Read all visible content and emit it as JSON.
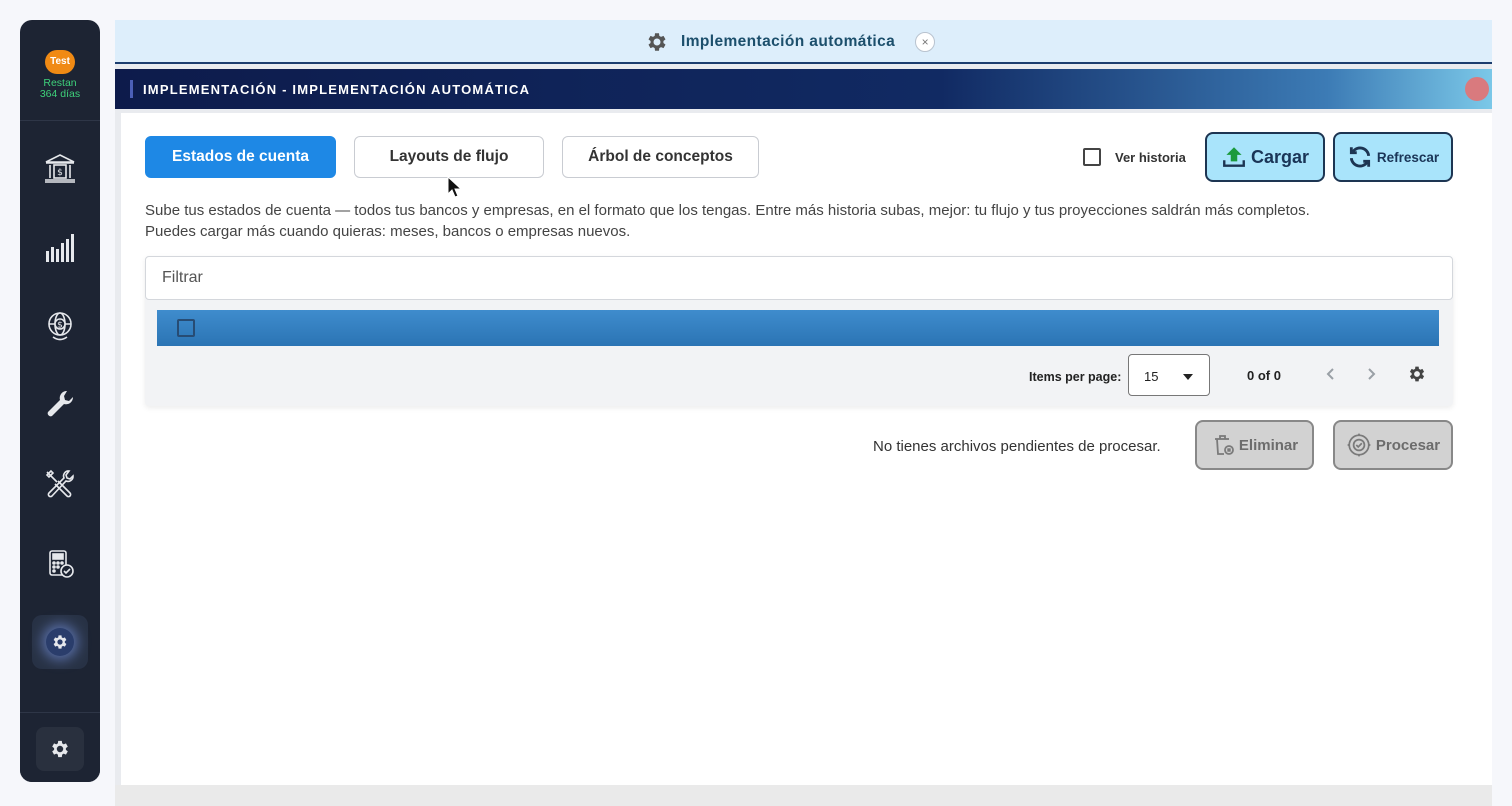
{
  "sidebar": {
    "trial_badge": "Test",
    "trial_days_line1": "Restan",
    "trial_days_line2": "364 días",
    "items": [
      {
        "icon": "bank-icon"
      },
      {
        "icon": "bar-chart-icon"
      },
      {
        "icon": "globe-dollar-icon"
      },
      {
        "icon": "wrench-icon"
      },
      {
        "icon": "tools-icon"
      },
      {
        "icon": "calculator-check-icon"
      },
      {
        "icon": "gear-icon",
        "active": true
      }
    ],
    "bottom_icon": "gear-icon"
  },
  "tab": {
    "title": "Implementación automática",
    "close_glyph": "×"
  },
  "header": {
    "title": "IMPLEMENTACIÓN - IMPLEMENTACIÓN AUTOMÁTICA"
  },
  "toolbar": {
    "segments": [
      {
        "label": "Estados de cuenta",
        "active": true
      },
      {
        "label": "Layouts de flujo",
        "active": false
      },
      {
        "label": "Árbol de conceptos",
        "active": false
      }
    ],
    "history_label": "Ver historia",
    "upload_label": "Cargar",
    "refresh_label": "Refrescar"
  },
  "description": {
    "line1": "Sube tus estados de cuenta — todos tus bancos y empresas, en el formato que los tengas. Entre más historia subas, mejor: tu flujo y tus proyecciones saldrán más completos.",
    "line2": "Puedes cargar más cuando quieras: meses, bancos o empresas nuevos."
  },
  "table": {
    "filter_placeholder": "Filtrar",
    "items_per_page_label": "Items per page:",
    "items_per_page_value": "15",
    "range_label": "0 of 0"
  },
  "footer": {
    "pending_text": "No tienes archivos pendientes de procesar.",
    "delete_label": "Eliminar",
    "process_label": "Procesar"
  },
  "colors": {
    "sidebar_bg": "#1d2433",
    "primary": "#1e88e5",
    "action_bg": "#a9e4fb",
    "table_header": "#2b74b4",
    "trial_badge": "#f08a14",
    "trial_text": "#3ed07a"
  }
}
